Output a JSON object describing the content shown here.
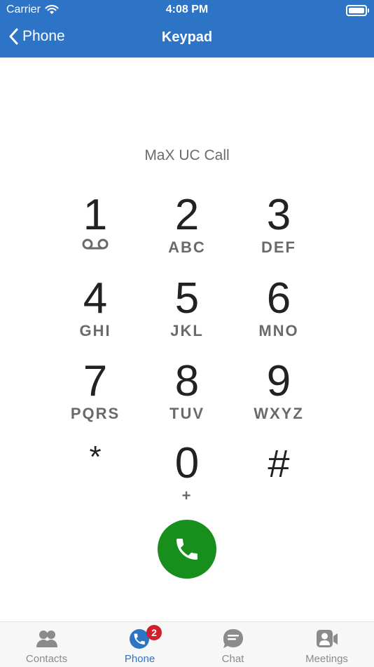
{
  "status_bar": {
    "carrier": "Carrier",
    "time": "4:08 PM"
  },
  "nav": {
    "back_label": "Phone",
    "title": "Keypad"
  },
  "dial_label": "MaX UC Call",
  "keypad": [
    {
      "digit": "1",
      "letters": ""
    },
    {
      "digit": "2",
      "letters": "ABC"
    },
    {
      "digit": "3",
      "letters": "DEF"
    },
    {
      "digit": "4",
      "letters": "GHI"
    },
    {
      "digit": "5",
      "letters": "JKL"
    },
    {
      "digit": "6",
      "letters": "MNO"
    },
    {
      "digit": "7",
      "letters": "PQRS"
    },
    {
      "digit": "8",
      "letters": "TUV"
    },
    {
      "digit": "9",
      "letters": "WXYZ"
    },
    {
      "digit": "*",
      "letters": ""
    },
    {
      "digit": "0",
      "letters": "+"
    },
    {
      "digit": "#",
      "letters": ""
    }
  ],
  "voicemail_icon": "voicemail-icon",
  "call_button": {
    "icon": "phone-icon",
    "color": "#188f1d"
  },
  "tabs": [
    {
      "label": "Contacts",
      "icon": "contacts-icon",
      "active": false
    },
    {
      "label": "Phone",
      "icon": "phone-icon",
      "active": true,
      "badge": "2"
    },
    {
      "label": "Chat",
      "icon": "chat-icon",
      "active": false
    },
    {
      "label": "Meetings",
      "icon": "meetings-icon",
      "active": false
    }
  ],
  "colors": {
    "header": "#2e74c6",
    "active_tab": "#2e74c6",
    "badge": "#d0202c",
    "inactive_tab": "#8b8b8b"
  }
}
